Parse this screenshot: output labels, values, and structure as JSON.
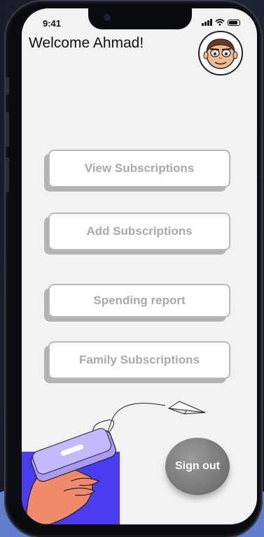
{
  "status_bar": {
    "time": "9:41",
    "icons": [
      "signal-icon",
      "wifi-icon",
      "battery-icon"
    ]
  },
  "header": {
    "welcome": "Welcome Ahmad!",
    "avatar_icon": "cartoon-face-avatar"
  },
  "menu": {
    "items": [
      {
        "label": "View Subscriptions"
      },
      {
        "label": "Add Subscriptions"
      },
      {
        "label": "Spending report"
      },
      {
        "label": "Family Subscriptions"
      }
    ]
  },
  "sign_out": {
    "label": "Sign out"
  },
  "illustration": {
    "icons": [
      "hand-holding-phone-icon",
      "paper-plane-icon"
    ]
  },
  "colors": {
    "screen_bg": "#f2f2f2",
    "button_text": "#a9a9a9",
    "button_shadow": "#b3b3b3",
    "signout_bg": "#7a7a7a",
    "illustration_blue": "#4b3cf0",
    "phone_purple": "#a99cf0",
    "skin": "#f08a6a"
  }
}
